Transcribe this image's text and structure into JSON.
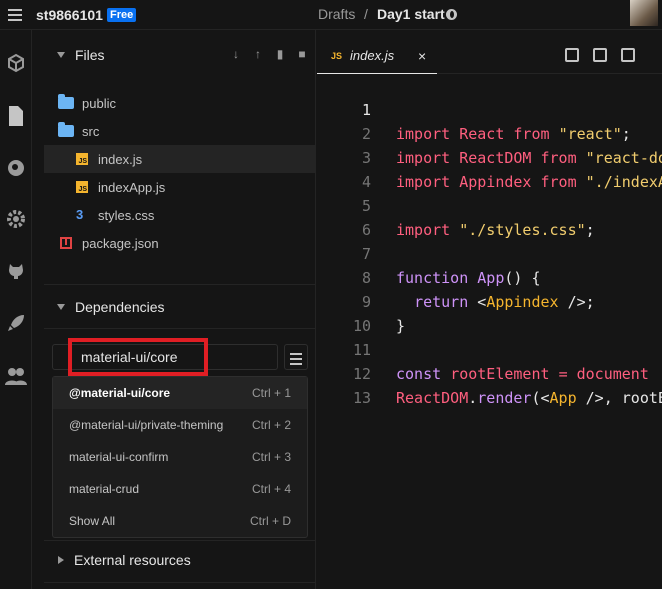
{
  "topbar": {
    "username": "st9866101",
    "plan_badge": "Free",
    "crumb_drafts": "Drafts",
    "crumb_separator": "/",
    "sandbox_title": "Day1 start"
  },
  "files_panel": {
    "title": "Files",
    "items": [
      {
        "label": "public",
        "type": "folder"
      },
      {
        "label": "src",
        "type": "folder"
      },
      {
        "label": "index.js",
        "type": "js"
      },
      {
        "label": "indexApp.js",
        "type": "js"
      },
      {
        "label": "styles.css",
        "type": "css"
      },
      {
        "label": "package.json",
        "type": "package"
      }
    ]
  },
  "dependencies": {
    "title": "Dependencies",
    "search_value": "material-ui/core",
    "suggestions": [
      {
        "prefix": "@material-ui/",
        "bold": "core",
        "label": "@material-ui/core",
        "shortcut": "Ctrl + 1"
      },
      {
        "label": "@material-ui/private-theming",
        "shortcut": "Ctrl + 2"
      },
      {
        "label": "material-ui-confirm",
        "shortcut": "Ctrl + 3"
      },
      {
        "label": "material-crud",
        "shortcut": "Ctrl + 4"
      },
      {
        "label": "Show All",
        "shortcut": "Ctrl + D"
      }
    ]
  },
  "external": {
    "title": "External resources"
  },
  "editor": {
    "tab_icon": "JS",
    "tab_name": "index.js",
    "tab_close": "×",
    "line_numbers": [
      "1",
      "2",
      "3",
      "4",
      "5",
      "6",
      "7",
      "8",
      "9",
      "10",
      "11",
      "12",
      "13"
    ]
  },
  "colors": {
    "accent_badge": "#0971f1",
    "annotation_red": "#e01e24",
    "keyword": "#ff5f7f",
    "string": "#f1cd6e",
    "function": "#ce93f8"
  }
}
